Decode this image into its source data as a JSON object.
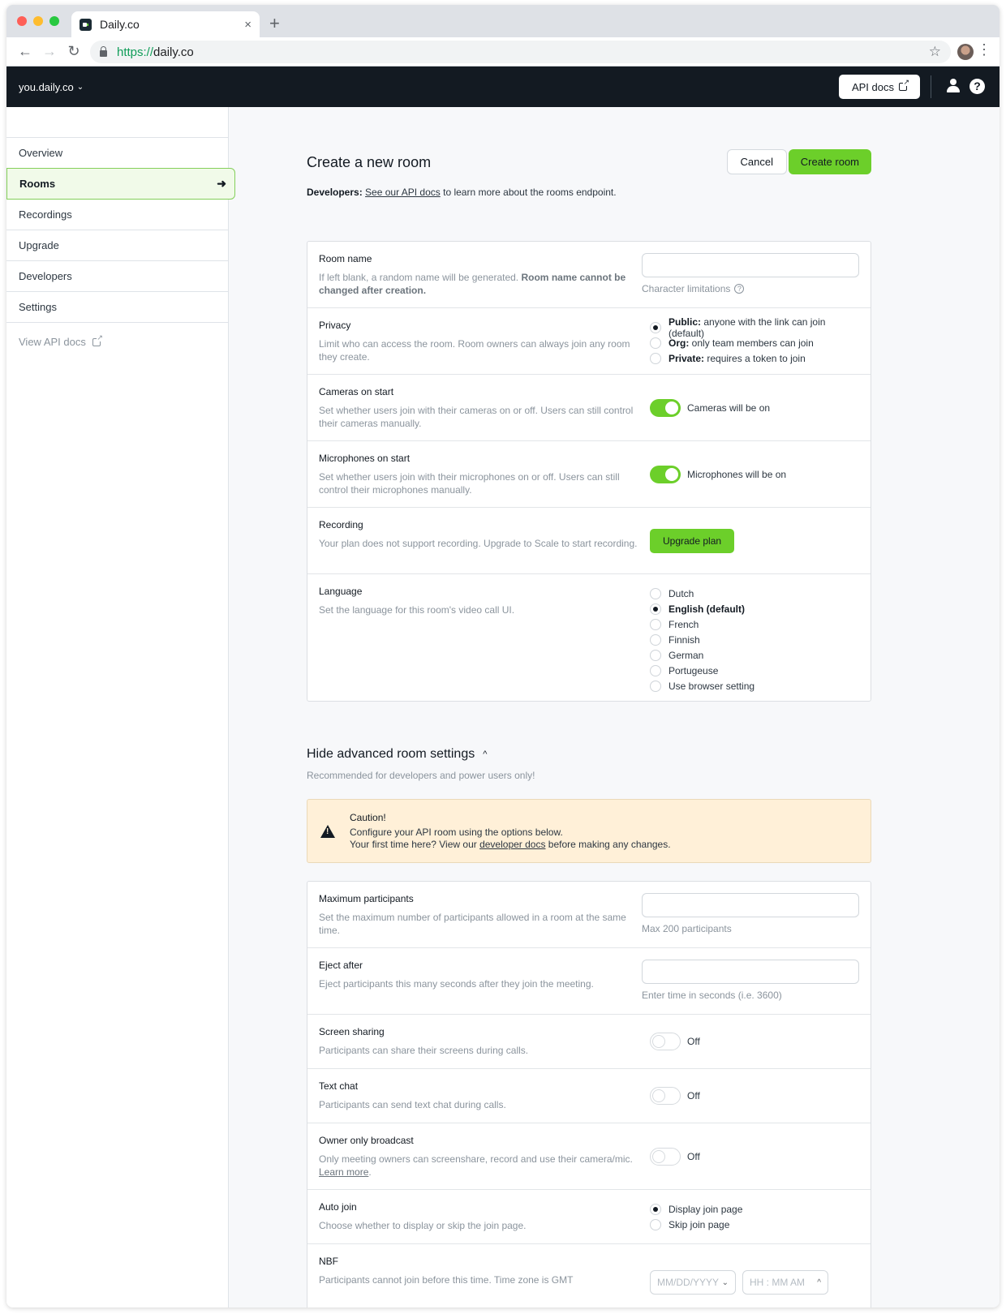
{
  "browser": {
    "tab_title": "Daily.co",
    "tab_close": "×",
    "new_tab": "+",
    "url_scheme": "https://",
    "url_host": "daily.co",
    "icons": {
      "back": "←",
      "forward": "→",
      "reload": "↻",
      "star": "☆",
      "menu": "⋮"
    }
  },
  "appbar": {
    "workspace": "you.daily.co",
    "workspace_chevron": "⌄",
    "api_docs": "API docs",
    "help": "?"
  },
  "sidebar": {
    "items": [
      {
        "label": "Overview",
        "active": false
      },
      {
        "label": "Rooms",
        "active": true
      },
      {
        "label": "Recordings",
        "active": false
      },
      {
        "label": "Upgrade",
        "active": false
      },
      {
        "label": "Developers",
        "active": false
      },
      {
        "label": "Settings",
        "active": false
      }
    ],
    "active_arrow": "➜",
    "view_api_docs": "View API docs"
  },
  "page": {
    "title": "Create a new room",
    "cancel": "Cancel",
    "create": "Create room",
    "dev_label": "Developers:",
    "dev_link": "See our API docs",
    "dev_rest": " to learn more about the rooms endpoint."
  },
  "basic": {
    "room_name": {
      "title": "Room name",
      "desc": "If left blank, a random name will be generated. ",
      "desc_bold": "Room name cannot be changed after creation.",
      "value": "",
      "hint": "Character limitations",
      "hint_icon": "?"
    },
    "privacy": {
      "title": "Privacy",
      "desc": "Limit who can access the room. Room owners can always join any room they create.",
      "options": [
        {
          "bold": "Public:",
          "text": " anyone with the link can join (default)",
          "checked": true
        },
        {
          "bold": "Org:",
          "text": " only team members can join",
          "checked": false
        },
        {
          "bold": "Private:",
          "text": " requires a token to join",
          "checked": false
        }
      ]
    },
    "cameras": {
      "title": "Cameras on start",
      "desc": "Set whether users join with their cameras on or off. Users can still control their cameras manually.",
      "toggle_on": true,
      "toggle_label": "Cameras will be on"
    },
    "microphones": {
      "title": "Microphones on start",
      "desc": "Set whether users join with their microphones on or off. Users can still control their microphones manually.",
      "toggle_on": true,
      "toggle_label": "Microphones will be on"
    },
    "recording": {
      "title": "Recording",
      "desc": "Your plan does not support recording. Upgrade to Scale to start recording.",
      "button": "Upgrade plan"
    },
    "language": {
      "title": "Language",
      "desc": "Set the language for this room's video call UI.",
      "options": [
        {
          "label": "Dutch",
          "checked": false
        },
        {
          "label": "English (default)",
          "checked": true
        },
        {
          "label": "French",
          "checked": false
        },
        {
          "label": "Finnish",
          "checked": false
        },
        {
          "label": "German",
          "checked": false
        },
        {
          "label": "Portugeuse",
          "checked": false
        },
        {
          "label": "Use browser setting",
          "checked": false
        }
      ]
    }
  },
  "advanced": {
    "toggle_title": "Hide advanced room settings",
    "caret": "^",
    "subtitle": "Recommended for developers and power users only!",
    "caution": {
      "title": "Caution!",
      "line1": "Configure your API room using the options below.",
      "line2_pre": "Your first time here? View our ",
      "line2_link": "developer docs",
      "line2_post": " before making any changes."
    },
    "max_participants": {
      "title": "Maximum participants",
      "desc": "Set the maximum number of participants allowed in a room at the same time.",
      "value": "",
      "hint": "Max 200 participants"
    },
    "eject_after": {
      "title": "Eject after",
      "desc": "Eject participants this many seconds after they join the meeting.",
      "value": "",
      "hint": "Enter time in seconds (i.e. 3600)"
    },
    "screen_sharing": {
      "title": "Screen sharing",
      "desc": "Participants can share their screens during calls.",
      "toggle_on": false,
      "toggle_label": "Off"
    },
    "text_chat": {
      "title": "Text chat",
      "desc": "Participants can send text chat during calls.",
      "toggle_on": false,
      "toggle_label": "Off"
    },
    "owner_broadcast": {
      "title": "Owner only broadcast",
      "desc": "Only meeting owners can screenshare, record and use their camera/mic. ",
      "desc_link": "Learn more",
      "desc_end": ".",
      "toggle_on": false,
      "toggle_label": "Off"
    },
    "auto_join": {
      "title": "Auto join",
      "desc": "Choose whether to display or skip the join page.",
      "options": [
        {
          "label": "Display join page",
          "checked": true
        },
        {
          "label": "Skip join page",
          "checked": false
        }
      ]
    },
    "nbf": {
      "title": "NBF",
      "desc": "Participants cannot join before this time. Time zone is GMT",
      "date_placeholder": "MM/DD/YYYY",
      "time_placeholder": "HH : MM AM",
      "date_icon": "⌄",
      "time_icon": "^"
    }
  }
}
